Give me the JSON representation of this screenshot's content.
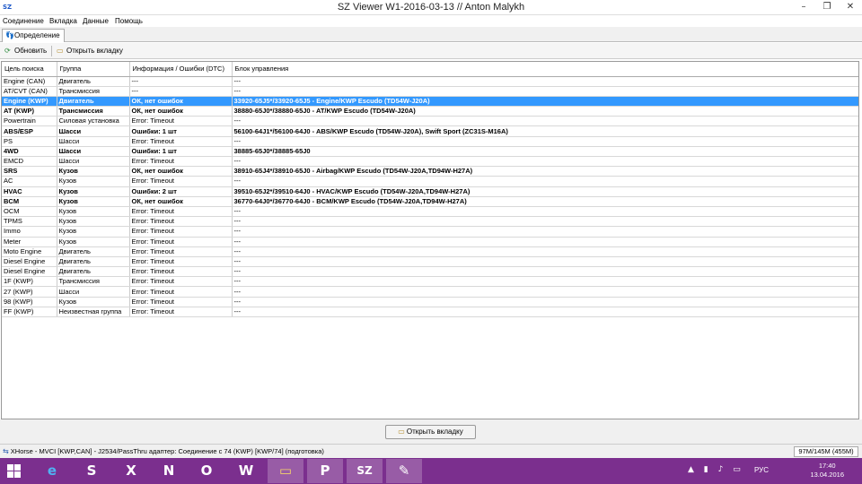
{
  "window": {
    "app_icon": "SZ",
    "title": "SZ Viewer W1-2016-03-13 // Anton Malykh",
    "buttons": {
      "minimize": "–",
      "maximize": "❐",
      "close": "✕"
    }
  },
  "menu": [
    "Соединение",
    "Вкладка",
    "Данные",
    "Помощь"
  ],
  "tab": {
    "icon": "footprints-icon",
    "label": "Определение"
  },
  "toolbar": {
    "refresh": {
      "icon": "refresh-icon",
      "label": "Обновить"
    },
    "open_tab": {
      "icon": "folder-icon",
      "label": "Открыть вкладку"
    }
  },
  "table": {
    "columns": [
      "Цель поиска",
      "Группа",
      "Информация / Ошибки (DTC)",
      "Блок управления"
    ],
    "rows": [
      {
        "target": "Engine (CAN)",
        "group": "Двигатель",
        "info": "---",
        "ecu": "---",
        "bold": false,
        "selected": false
      },
      {
        "target": "AT/CVT (CAN)",
        "group": "Трансмиссия",
        "info": "---",
        "ecu": "---",
        "bold": false,
        "selected": false
      },
      {
        "target": "Engine (KWP)",
        "group": "Двигатель",
        "info": "ОК, нет ошибок",
        "ecu": "33920-65J5*/33920-65J5 - Engine/KWP Escudo (TD54W-J20A)",
        "bold": true,
        "selected": true
      },
      {
        "target": "AT (KWP)",
        "group": "Трансмиссия",
        "info": "ОК, нет ошибок",
        "ecu": "38880-65J0*/38880-65J0 - AT/KWP Escudo (TD54W-J20A)",
        "bold": true,
        "selected": false
      },
      {
        "target": "Powertrain",
        "group": "Силовая установка",
        "info": "Error: Timeout",
        "ecu": "---",
        "bold": false,
        "selected": false
      },
      {
        "target": "ABS/ESP",
        "group": "Шасси",
        "info": "Ошибки: 1 шт",
        "ecu": "56100-64J1*/56100-64J0 - ABS/KWP Escudo (TD54W-J20A), Swift Sport (ZC31S-M16A)",
        "bold": true,
        "selected": false
      },
      {
        "target": "PS",
        "group": "Шасси",
        "info": "Error: Timeout",
        "ecu": "---",
        "bold": false,
        "selected": false
      },
      {
        "target": "4WD",
        "group": "Шасси",
        "info": "Ошибки: 1 шт",
        "ecu": "38885-65J0*/38885-65J0",
        "bold": true,
        "selected": false
      },
      {
        "target": "EMCD",
        "group": "Шасси",
        "info": "Error: Timeout",
        "ecu": "---",
        "bold": false,
        "selected": false
      },
      {
        "target": "SRS",
        "group": "Кузов",
        "info": "ОК, нет ошибок",
        "ecu": "38910-65J4*/38910-65J0 - Airbag/KWP Escudo (TD54W-J20A,TD94W-H27A)",
        "bold": true,
        "selected": false
      },
      {
        "target": "AC",
        "group": "Кузов",
        "info": "Error: Timeout",
        "ecu": "---",
        "bold": false,
        "selected": false
      },
      {
        "target": "HVAC",
        "group": "Кузов",
        "info": "Ошибки: 2 шт",
        "ecu": "39510-65J2*/39510-64J0 - HVAC/KWP Escudo (TD54W-J20A,TD94W-H27A)",
        "bold": true,
        "selected": false
      },
      {
        "target": "BCM",
        "group": "Кузов",
        "info": "ОК, нет ошибок",
        "ecu": "36770-64J0*/36770-64J0 - BCM/KWP Escudo (TD54W-J20A,TD94W-H27A)",
        "bold": true,
        "selected": false
      },
      {
        "target": "OCM",
        "group": "Кузов",
        "info": "Error: Timeout",
        "ecu": "---",
        "bold": false,
        "selected": false
      },
      {
        "target": "TPMS",
        "group": "Кузов",
        "info": "Error: Timeout",
        "ecu": "---",
        "bold": false,
        "selected": false
      },
      {
        "target": "Immo",
        "group": "Кузов",
        "info": "Error: Timeout",
        "ecu": "---",
        "bold": false,
        "selected": false
      },
      {
        "target": "Meter",
        "group": "Кузов",
        "info": "Error: Timeout",
        "ecu": "---",
        "bold": false,
        "selected": false
      },
      {
        "target": "Moto Engine",
        "group": "Двигатель",
        "info": "Error: Timeout",
        "ecu": "---",
        "bold": false,
        "selected": false
      },
      {
        "target": "Diesel Engine",
        "group": "Двигатель",
        "info": "Error: Timeout",
        "ecu": "---",
        "bold": false,
        "selected": false
      },
      {
        "target": "Diesel Engine",
        "group": "Двигатель",
        "info": "Error: Timeout",
        "ecu": "---",
        "bold": false,
        "selected": false
      },
      {
        "target": "1F (KWP)",
        "group": "Трансмиссия",
        "info": "Error: Timeout",
        "ecu": "---",
        "bold": false,
        "selected": false
      },
      {
        "target": "27 (KWP)",
        "group": "Шасси",
        "info": "Error: Timeout",
        "ecu": "---",
        "bold": false,
        "selected": false
      },
      {
        "target": "98 (KWP)",
        "group": "Кузов",
        "info": "Error: Timeout",
        "ecu": "---",
        "bold": false,
        "selected": false
      },
      {
        "target": "FF (KWP)",
        "group": "Неизвестная группа",
        "info": "Error: Timeout",
        "ecu": "---",
        "bold": false,
        "selected": false
      }
    ]
  },
  "bottom_button": {
    "icon": "folder-icon",
    "label": "Открыть вкладку"
  },
  "status": {
    "icon": "connection-icon",
    "text": "XHorse - MVCI [KWP,CAN] - J2534/PassThru адаптер: Соединение с 74  (KWP) [KWP/74] (подготовка)",
    "memory": "97M/145M (455M)"
  },
  "taskbar": {
    "apps": [
      {
        "name": "internet-explorer",
        "glyph": "e",
        "color": "#4fb3f2",
        "active": false
      },
      {
        "name": "skype",
        "glyph": "S",
        "color": "#ffffff",
        "active": false
      },
      {
        "name": "excel",
        "glyph": "X",
        "color": "#ffffff",
        "active": false
      },
      {
        "name": "onenote",
        "glyph": "N",
        "color": "#ffffff",
        "active": false
      },
      {
        "name": "outlook",
        "glyph": "O",
        "color": "#ffffff",
        "active": false
      },
      {
        "name": "word",
        "glyph": "W",
        "color": "#ffffff",
        "active": false
      },
      {
        "name": "file-explorer",
        "glyph": "▭",
        "color": "#f5d36a",
        "active": true
      },
      {
        "name": "powerpoint",
        "glyph": "P",
        "color": "#ffffff",
        "active": true
      },
      {
        "name": "sz-viewer",
        "glyph": "SZ",
        "color": "#ffffff",
        "active": true
      },
      {
        "name": "paint",
        "glyph": "✎",
        "color": "#ffffff",
        "active": true
      }
    ],
    "language": "РУС",
    "time": "17:40",
    "date": "13.04.2016",
    "accent": "#7b2f8e"
  }
}
